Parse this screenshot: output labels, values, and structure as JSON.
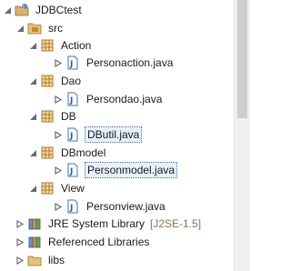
{
  "tree": {
    "project": "JDBCtest",
    "src": "src",
    "packages": [
      {
        "name": "Action",
        "file": "Personaction.java"
      },
      {
        "name": "Dao",
        "file": "Persondao.java"
      },
      {
        "name": "DB",
        "file": "DButil.java"
      },
      {
        "name": "DBmodel",
        "file": "Personmodel.java"
      },
      {
        "name": "View",
        "file": "Personview.java"
      }
    ],
    "libraries": [
      {
        "name": "JRE System Library",
        "suffix": "[J2SE-1.5]"
      },
      {
        "name": "Referenced Libraries"
      },
      {
        "name": "libs"
      }
    ]
  },
  "selected_file": "Personmodel.java",
  "colors": {
    "accent": "#4a6fa5",
    "package": "#b07a2a",
    "java": "#1f5ea8",
    "selection": "#e8f1fb"
  }
}
